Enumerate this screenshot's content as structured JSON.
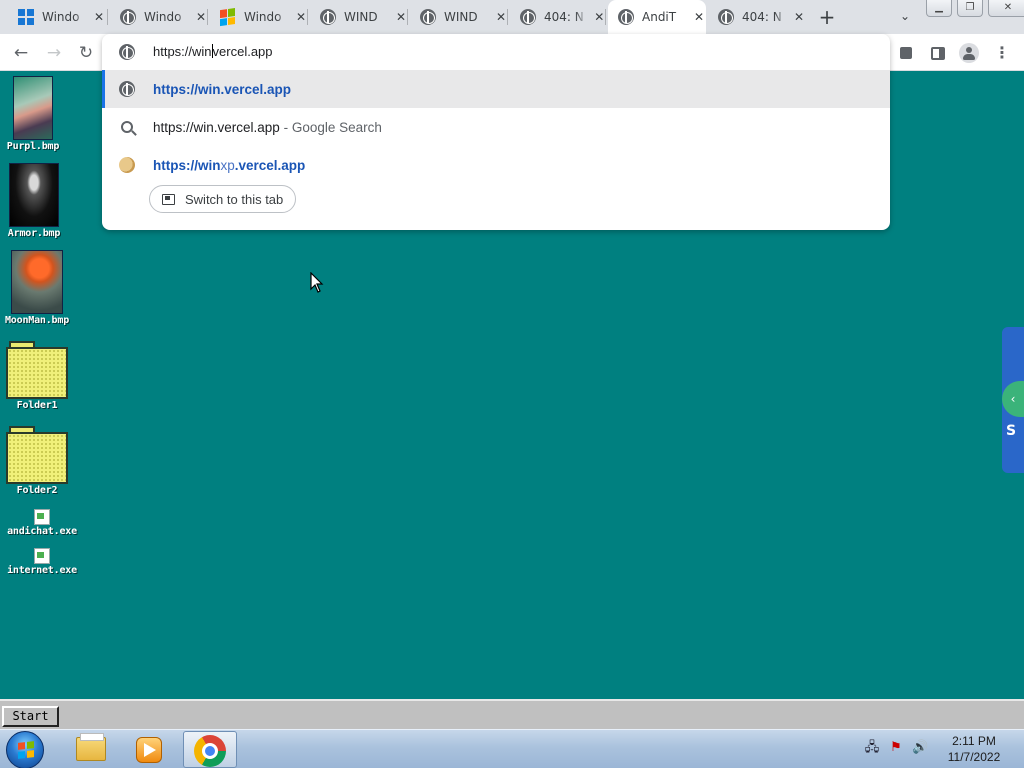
{
  "tabs": [
    {
      "title": "Windo",
      "favicon": "windows-logo-icon"
    },
    {
      "title": "Windo",
      "favicon": "globe-icon"
    },
    {
      "title": "Windo",
      "favicon": "windows-xp-logo-icon"
    },
    {
      "title": "WIND",
      "favicon": "globe-icon"
    },
    {
      "title": "WIND",
      "favicon": "globe-icon"
    },
    {
      "title": "404: N",
      "favicon": "globe-icon"
    },
    {
      "title": "AndiT",
      "favicon": "globe-icon",
      "active": true
    },
    {
      "title": "404: N",
      "favicon": "globe-icon"
    }
  ],
  "omnibox": {
    "typed_before_caret": "https://win",
    "typed_after_caret": "vercel.app",
    "suggestions": [
      {
        "type": "url",
        "text": "https://win.vercel.app",
        "selected": true
      },
      {
        "type": "search",
        "text": "https://win.vercel.app",
        "suffix": " - Google Search"
      },
      {
        "type": "url",
        "text_bold_1": "https://win",
        "text_dim": "xp",
        "text_bold_2": ".vercel.app"
      }
    ],
    "switch_tab_label": "Switch to this tab"
  },
  "desktop": {
    "background": "#008080",
    "icons": [
      {
        "label": "Purpl.bmp"
      },
      {
        "label": "Armor.bmp"
      },
      {
        "label": "MoonMan.bmp"
      },
      {
        "label": "Folder1"
      },
      {
        "label": "Folder2"
      },
      {
        "label": "andichat.exe"
      },
      {
        "label": "internet.exe"
      }
    ]
  },
  "startbar": {
    "start_label": "Start"
  },
  "taskbar": {
    "pinned": [
      "windows-explorer-icon",
      "media-player-icon",
      "chrome-icon"
    ],
    "active_app": "chrome-icon",
    "tray_icons": [
      "network-icon",
      "action-center-flag-icon",
      "volume-icon"
    ],
    "time": "2:11 PM",
    "date": "11/7/2022"
  },
  "colors": {
    "accent_blue": "#1a73e8",
    "link_blue": "#1a55b5",
    "desktop_teal": "#008080"
  }
}
